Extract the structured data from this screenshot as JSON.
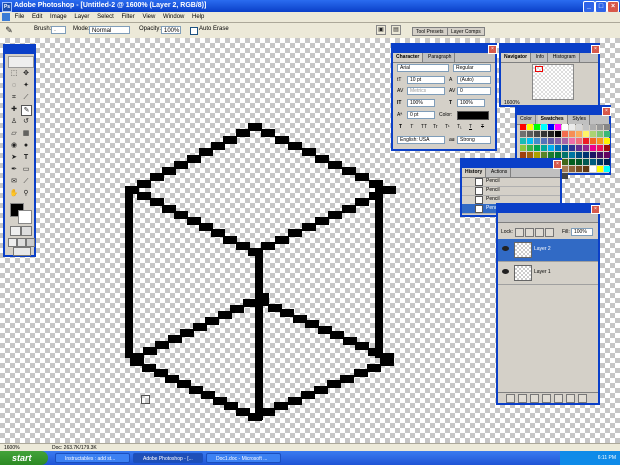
{
  "window": {
    "title": "Adobe Photoshop - [Untitled-2 @ 1600% (Layer 2, RGB/8)]",
    "min_label": "_",
    "max_label": "□",
    "close_label": "×"
  },
  "menu": [
    "File",
    "Edit",
    "Image",
    "Layer",
    "Select",
    "Filter",
    "View",
    "Window",
    "Help"
  ],
  "options_bar": {
    "brush_label": "Brush:",
    "mode_label": "Mode:",
    "mode_value": "Normal",
    "opacity_label": "Opacity:",
    "opacity_value": "100%",
    "auto_erase_label": "Auto Erase"
  },
  "palette_well": [
    "Tool Presets",
    "Layer Comps"
  ],
  "character_panel": {
    "tabs": [
      "Character",
      "Paragraph"
    ],
    "font_family": "Arial",
    "font_style": "Regular",
    "font_size": "10 pt",
    "leading": "(Auto)",
    "kerning": "Metrics",
    "tracking": "0",
    "vertical_scale": "100%",
    "horizontal_scale": "100%",
    "baseline_shift": "0 pt",
    "color_label": "Color:",
    "style_buttons": [
      "T",
      "T",
      "TT",
      "Tr",
      "T¹",
      "T₁",
      "T",
      "T"
    ],
    "language": "English: USA",
    "aa_label": "aa",
    "antialias": "Strong"
  },
  "navigator_panel": {
    "tabs": [
      "Navigator",
      "Info",
      "Histogram"
    ],
    "zoom": "1600%"
  },
  "color_panel": {
    "tabs": [
      "Color",
      "Swatches",
      "Styles"
    ],
    "swatches": [
      "#ff0000",
      "#ffff00",
      "#00ff00",
      "#00ffff",
      "#0000ff",
      "#ff00ff",
      "#ffffff",
      "#ebebeb",
      "#d6d6d6",
      "#c2c2c2",
      "#adadad",
      "#999999",
      "#858585",
      "#707070",
      "#5c5c5c",
      "#474747",
      "#333333",
      "#1f1f1f",
      "#000000",
      "#f26c4f",
      "#f68e55",
      "#fbad5c",
      "#fff467",
      "#acd372",
      "#7cc576",
      "#3bb878",
      "#1abbb4",
      "#00bff3",
      "#438ccb",
      "#5574b9",
      "#605ca8",
      "#855fa8",
      "#a763a8",
      "#f06ea9",
      "#f26d7d",
      "#ed1c24",
      "#f26522",
      "#f7941d",
      "#fff200",
      "#8dc63f",
      "#39b54a",
      "#00a651",
      "#00a99d",
      "#00aeef",
      "#0072bc",
      "#0054a6",
      "#2e3192",
      "#662d91",
      "#92278f",
      "#ec008c",
      "#ed145b",
      "#9e0b0f",
      "#a0410d",
      "#a3620a",
      "#aba000",
      "#598527",
      "#1a7b30",
      "#007236",
      "#00746b",
      "#0076a3",
      "#004b80",
      "#003471",
      "#1b1464",
      "#440e62",
      "#630460",
      "#9e005d",
      "#9e0039",
      "#790000",
      "#7b2e00",
      "#7d4900",
      "#827b00",
      "#406618",
      "#005e20",
      "#005826",
      "#005952",
      "#005b7f",
      "#003663",
      "#002157",
      "#0d004c",
      "#32004b",
      "#4b0049",
      "#7b0046",
      "#7a0026",
      "#c69c6d",
      "#a67c52",
      "#8c6239",
      "#754c24",
      "#603913",
      "#ffffff",
      "#ffff00",
      "#00ffff",
      "#ff00ff",
      "#ff0000",
      "#00ff00",
      "#0000ff",
      "#000000",
      "#222222",
      "#444444"
    ]
  },
  "history_panel": {
    "tabs": [
      "History",
      "Actions"
    ],
    "items": [
      "Pencil",
      "Pencil",
      "Pencil",
      "Pencil"
    ]
  },
  "layers_panel": {
    "lock_label": "Lock:",
    "fill_label": "Fill:",
    "fill_value": "100%",
    "layers": [
      {
        "name": "Layer 2",
        "selected": true
      },
      {
        "name": "Layer 1",
        "selected": false
      }
    ]
  },
  "status_bar": {
    "zoom": "1600%",
    "doc_info": "Doc: 263.7K/179.3K"
  },
  "taskbar": {
    "start": "start",
    "items": [
      "Instructables : add st...",
      "Adobe Photoshop - [...",
      "Doc1.doc - Microsoft ..."
    ],
    "clock": "6:11 PM"
  },
  "colors": {
    "xp_blue": "#0a3fc8",
    "selection_blue": "#316ac5",
    "foreground": "#000000",
    "background": "#ffffff"
  }
}
